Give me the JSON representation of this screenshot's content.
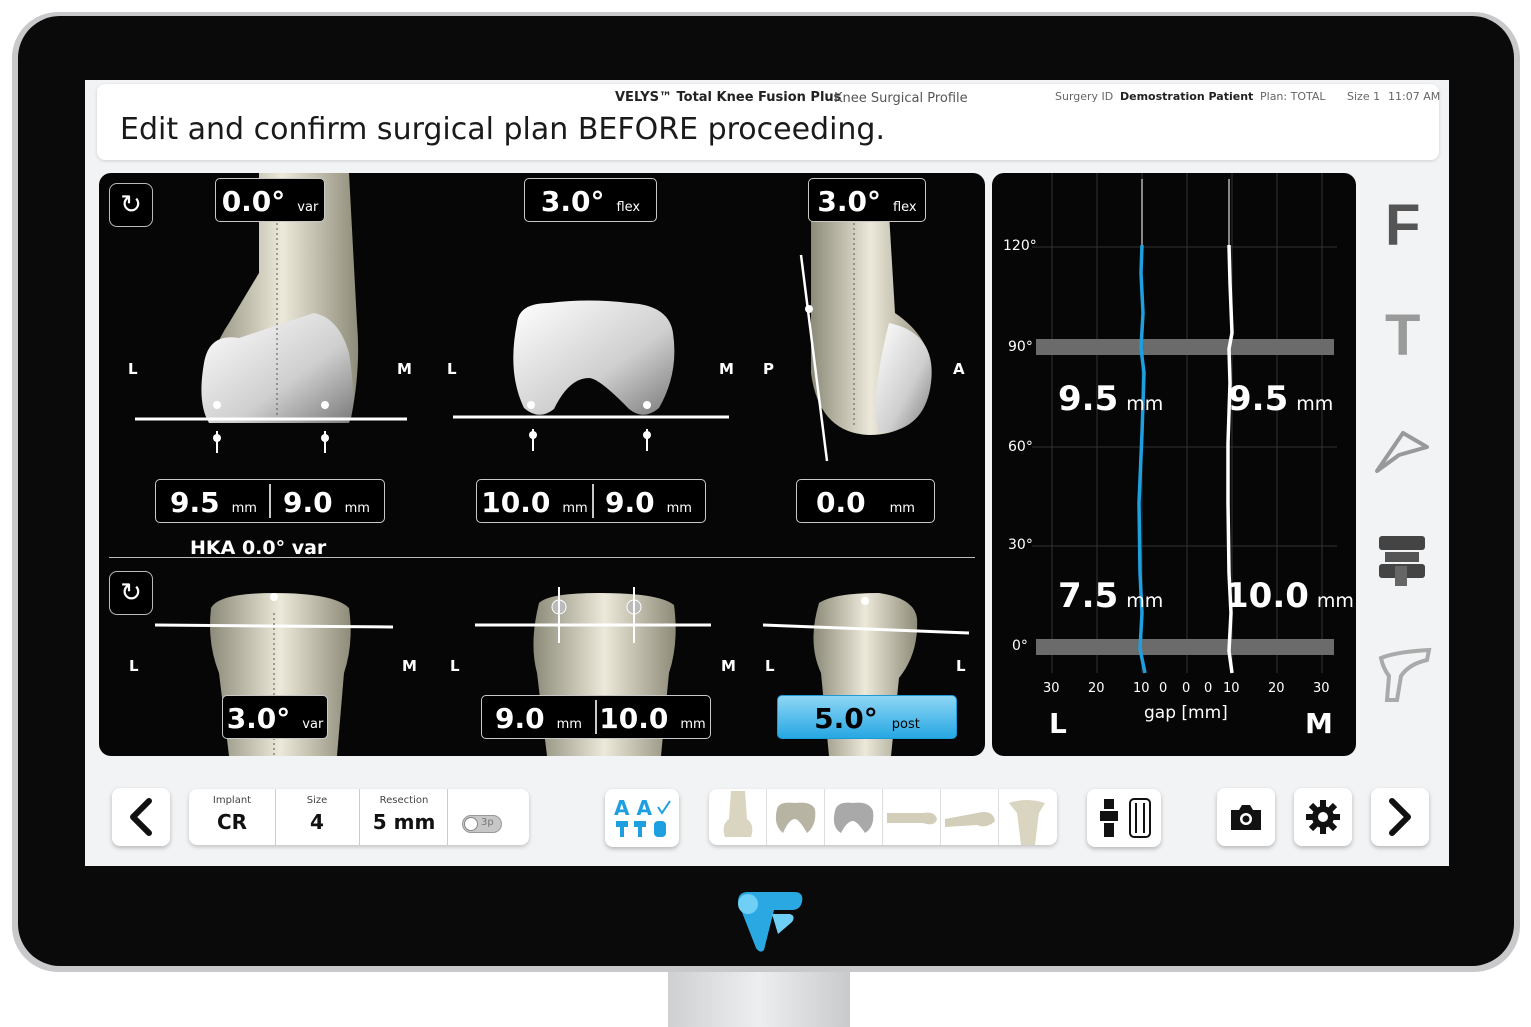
{
  "header": {
    "product_name": "VELYS™ Total Knee Fusion Plus",
    "profile": "Knee Surgical Profile",
    "surgery_id_label": "Surgery ID",
    "patient": "Demostration Patient",
    "plan": "Plan: TOTAL",
    "size": "Size 1",
    "time": "11:07 AM",
    "instruction": "Edit and confirm surgical plan BEFORE proceeding."
  },
  "femur": {
    "coronal": {
      "angle": "0.0°",
      "angle_unit": "var",
      "left_label": "L",
      "right_label": "M",
      "res_left": "9.5",
      "res_right": "9.0",
      "unit": "mm"
    },
    "axial": {
      "angle": "3.0°",
      "angle_unit": "flex",
      "left_label": "L",
      "right_label": "M",
      "res_left": "10.0",
      "res_right": "9.0",
      "unit": "mm"
    },
    "sagittal": {
      "angle": "3.0°",
      "angle_unit": "flex",
      "left_label": "P",
      "right_label": "A",
      "res": "0.0",
      "unit": "mm"
    }
  },
  "hka": "HKA 0.0° var",
  "tibia": {
    "coronal": {
      "angle": "3.0°",
      "angle_unit": "var",
      "left_label": "L",
      "right_label": "M"
    },
    "axial": {
      "left_label": "L",
      "right_label": "M",
      "res_left": "9.0",
      "res_right": "10.0",
      "unit": "mm"
    },
    "sagittal": {
      "angle": "5.0°",
      "angle_unit": "post",
      "left_label": "L",
      "right_label": "L"
    }
  },
  "gap_chart": {
    "angles": [
      "120°",
      "90°",
      "60°",
      "30°",
      "0°"
    ],
    "x_ticks": [
      "30",
      "20",
      "10",
      "0",
      "0",
      "0",
      "10",
      "20",
      "30"
    ],
    "x_label": "gap [mm]",
    "left_side": "L",
    "right_side": "M",
    "flexion_left": "9.5",
    "flexion_right": "9.5",
    "extension_left": "7.5",
    "extension_right": "10.0",
    "unit": "mm",
    "colors": {
      "lateral": "#1e9fe0",
      "medial": "#ffffff",
      "band": "#6b6b6b"
    }
  },
  "rail": {
    "femur": "F",
    "tibia": "T"
  },
  "toolbar": {
    "implant_label": "Implant",
    "implant_value": "CR",
    "size_label": "Size",
    "size_value": "4",
    "resection_label": "Resection",
    "resection_value": "5 mm",
    "toggle_text": "3p"
  },
  "colors": {
    "accent": "#26a7e3",
    "panel": "#060606",
    "screen": "#f2f3f4"
  }
}
